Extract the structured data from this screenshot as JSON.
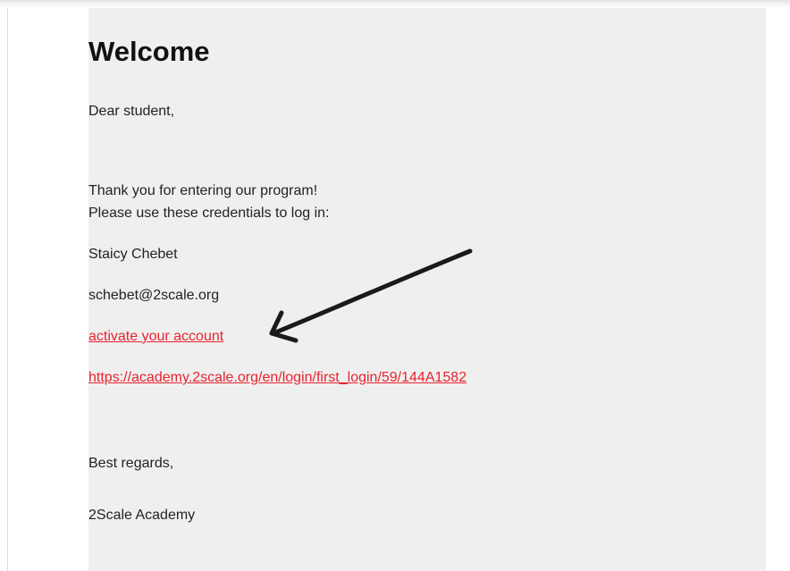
{
  "email": {
    "heading": "Welcome",
    "greeting": "Dear student,",
    "thanks": "Thank you for entering our program!",
    "instruction": "Please use these credentials to log in:",
    "name": "Staicy Chebet",
    "email_address": "schebet@2scale.org",
    "activate_link": "activate your account",
    "login_url": "https://academy.2scale.org/en/login/first_login/59/144A1582",
    "closing": "Best regards,",
    "signature": "2Scale Academy"
  },
  "annotation": {
    "arrow_color": "#1a1a1a"
  },
  "colors": {
    "link": "#e8232f",
    "background": "#efefef"
  }
}
